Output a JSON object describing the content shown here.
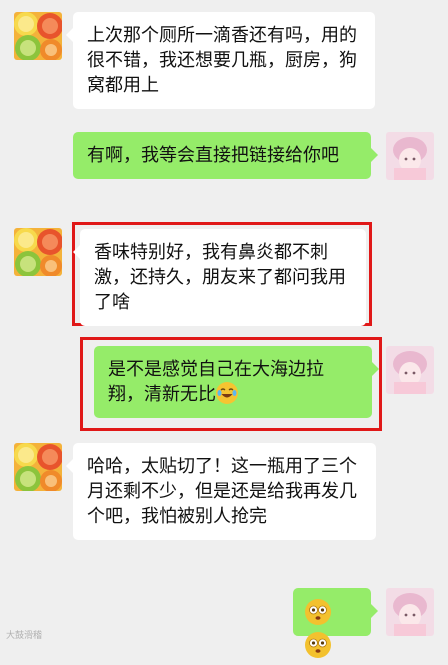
{
  "colors": {
    "background": "#efefef",
    "bubble_left": "#ffffff",
    "bubble_right": "#95ec69",
    "highlight": "#e01818"
  },
  "messages": [
    {
      "side": "left",
      "avatar": "fruit-avatar",
      "text": "上次那个厕所一滴香还有吗，用的很不错，我还想要几瓶，厨房，狗窝都用上"
    },
    {
      "side": "right",
      "avatar": "girl-avatar",
      "text": "有啊，我等会直接把链接给你吧"
    },
    {
      "side": "left",
      "avatar": "fruit-avatar",
      "text": "香味特别好，我有鼻炎都不刺激，还持久，朋友来了都问我用了啥",
      "highlighted": true
    },
    {
      "side": "right",
      "avatar": "girl-avatar",
      "text": "是不是感觉自己在大海边拉翔，清新无比",
      "emoji": "tears-of-joy",
      "highlighted": true
    },
    {
      "side": "left",
      "avatar": "fruit-avatar",
      "text": "哈哈，太贴切了！这一瓶用了三个月还剩不少，但是还是给我再发几个吧，我怕被别人抢完"
    },
    {
      "side": "right",
      "avatar": "girl-avatar",
      "emoji_only": [
        "heart-eyes",
        "heart-eyes"
      ]
    }
  ],
  "watermark": "大鼓滑稽"
}
